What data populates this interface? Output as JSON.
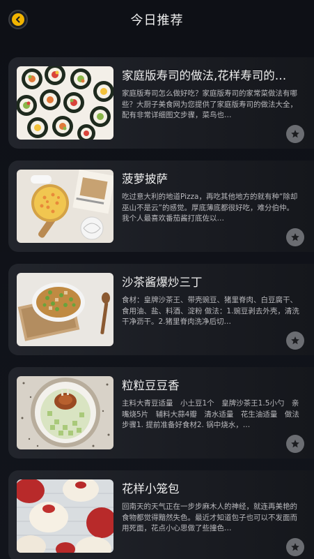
{
  "header": {
    "title": "今日推荐",
    "back_icon": "back-arrow-icon",
    "accent_color": "#f2b400"
  },
  "recipes": [
    {
      "title": "家庭版寿司的做法,花样寿司的…",
      "desc": "家庭版寿司怎么做好吃？家庭版寿司的家常菜做法有哪些？大厨子美食网为您提供了家庭版寿司的做法大全，配有非常详细图文步骤，菜鸟也…",
      "image": "sushi rolls on plate",
      "fav_icon": "star-icon"
    },
    {
      "title": "菠萝披萨",
      "desc": "吃过意大利的地道Pizza，再吃其他地方的就有种“除却巫山不是云”的感觉。厚底薄底都很好吃，难分伯仲。我个人最喜欢番茄酱打底佐以…",
      "image": "pineapple pizza on board",
      "fav_icon": "star-icon"
    },
    {
      "title": "沙茶酱爆炒三丁",
      "desc": "食材：皇牌沙茶王、带壳豌豆、猪里脊肉、白豆腐干、食用油、盐、料酒、淀粉 做法：1.豌豆剥去外壳，清洗干净沥干。2.猪里脊肉洗净后切…",
      "image": "stir fried peas and pork",
      "fav_icon": "star-icon"
    },
    {
      "title": "粒粒豆豆香",
      "desc": "主料大青豆适量　小土豆1个　皇牌沙茶王1.5小勺　亲嘴烧5片　辅料大蒜4瓣　清水适量　花生油适量　做法步骤1. 提前准备好食材2. 锅中烧水，…",
      "image": "green beans and potato dish",
      "fav_icon": "star-icon"
    },
    {
      "title": "花样小笼包",
      "desc": "回南天的天气正在一步步麻木人的神经，就连再美艳的食物都觉得黯然失色。最近才知道包子也可以不发面而用死面，花点小心思做了些撞色…",
      "image": "steamed buns with red tops",
      "fav_icon": "star-icon"
    }
  ]
}
